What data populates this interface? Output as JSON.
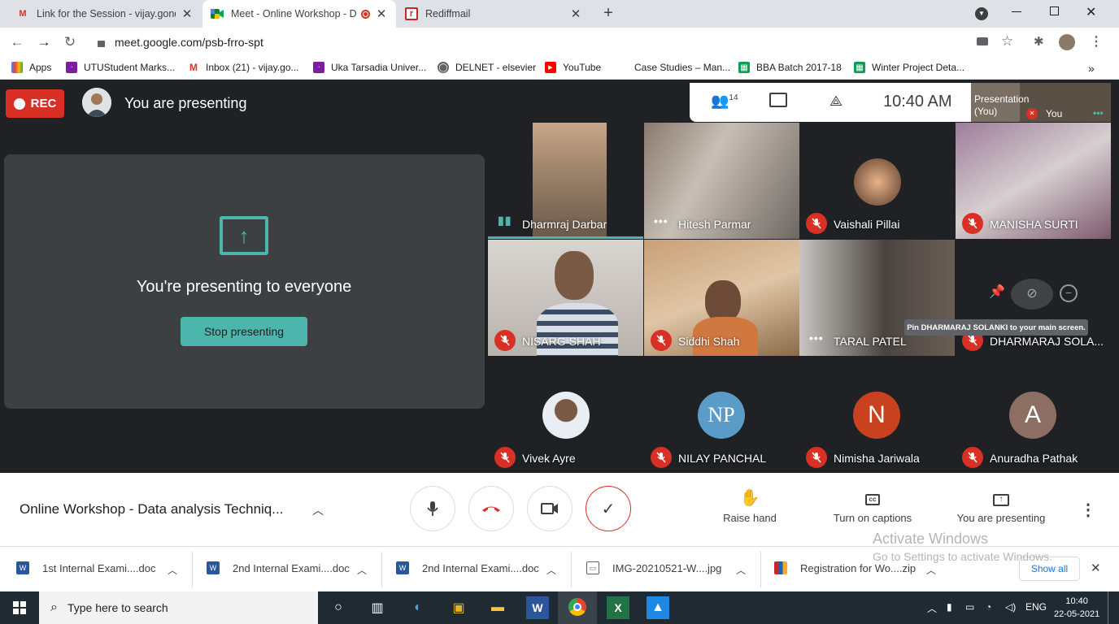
{
  "tabs": [
    {
      "title": "Link for the Session - vijay.gonda",
      "favicon": "gmail-icon",
      "close": "✕"
    },
    {
      "title": "Meet - Online Workshop - D",
      "favicon": "meet-icon",
      "close": "✕"
    },
    {
      "title": "Rediffmail",
      "favicon": "rediff-icon",
      "close": "✕"
    }
  ],
  "new_tab": "+",
  "url": "meet.google.com/psb-frro-spt",
  "bookmarks": [
    {
      "label": "Apps",
      "icon": "apps-grid-icon"
    },
    {
      "label": "UTUStudent Marks...",
      "icon": "uka-icon"
    },
    {
      "label": "Inbox (21) - vijay.go...",
      "icon": "gmail-icon"
    },
    {
      "label": "Uka Tarsadia Univer...",
      "icon": "uka-icon"
    },
    {
      "label": "DELNET - elsevier",
      "icon": "globe-icon"
    },
    {
      "label": "YouTube",
      "icon": "youtube-icon"
    },
    {
      "label": "Case Studies – Man...",
      "icon": "blank-icon"
    },
    {
      "label": "BBA Batch 2017-18",
      "icon": "sheets-icon"
    },
    {
      "label": "Winter Project Deta...",
      "icon": "sheets-icon"
    }
  ],
  "bookmarks_more": "»",
  "meet": {
    "rec_label": "REC",
    "presenting_title": "You are presenting",
    "present_message": "You're presenting to everyone",
    "stop_label": "Stop presenting",
    "participant_count": "14",
    "time": "10:40 AM",
    "presentation_label": "Presentation\n(You)",
    "you_label": "You",
    "tooltip": "Pin DHARMARAJ SOLANKI to your main screen."
  },
  "participants": [
    {
      "name": "Dharmraj Darbar",
      "state": "speaking"
    },
    {
      "name": "Hitesh Parmar",
      "state": "dots"
    },
    {
      "name": "Vaishali Pillai",
      "state": "muted"
    },
    {
      "name": "MANISHA SURTI",
      "state": "muted"
    },
    {
      "name": "NISARG SHAH",
      "state": "muted"
    },
    {
      "name": "Siddhi Shah",
      "state": "muted"
    },
    {
      "name": "TARAL PATEL",
      "state": "dots"
    },
    {
      "name": "DHARMARAJ SOLA...",
      "state": "muted"
    },
    {
      "name": "Vivek Ayre",
      "state": "muted"
    },
    {
      "name": "NILAY PANCHAL",
      "state": "muted"
    },
    {
      "name": "Nimisha Jariwala",
      "state": "muted",
      "initial": "N"
    },
    {
      "name": "Anuradha Pathak",
      "state": "muted",
      "initial": "A"
    }
  ],
  "colors": {
    "accent_teal": "#4db6ac",
    "rec_red": "#d93025",
    "nimisha_avatar": "#c9421f",
    "anuradha_avatar": "#8d6e63",
    "nilay_avatar": "#5b9bc8"
  },
  "controls": {
    "meeting_title": "Online Workshop - Data analysis Techniq...",
    "raise_hand": "Raise hand",
    "captions": "Turn on captions",
    "you_presenting": "You are presenting"
  },
  "watermark": {
    "line1": "Activate Windows",
    "line2": "Go to Settings to activate Windows."
  },
  "downloads": [
    {
      "name": "1st  Internal Exami....doc",
      "icon": "word-icon"
    },
    {
      "name": "2nd Internal Exami....doc",
      "icon": "word-icon"
    },
    {
      "name": "2nd Internal Exami....doc",
      "icon": "word-icon"
    },
    {
      "name": "IMG-20210521-W....jpg",
      "icon": "image-file-icon"
    },
    {
      "name": "Registration for Wo....zip",
      "icon": "zip-icon"
    }
  ],
  "show_all": "Show all",
  "taskbar": {
    "search_placeholder": "Type here to search",
    "lang": "ENG",
    "time": "10:40",
    "date": "22-05-2021"
  }
}
